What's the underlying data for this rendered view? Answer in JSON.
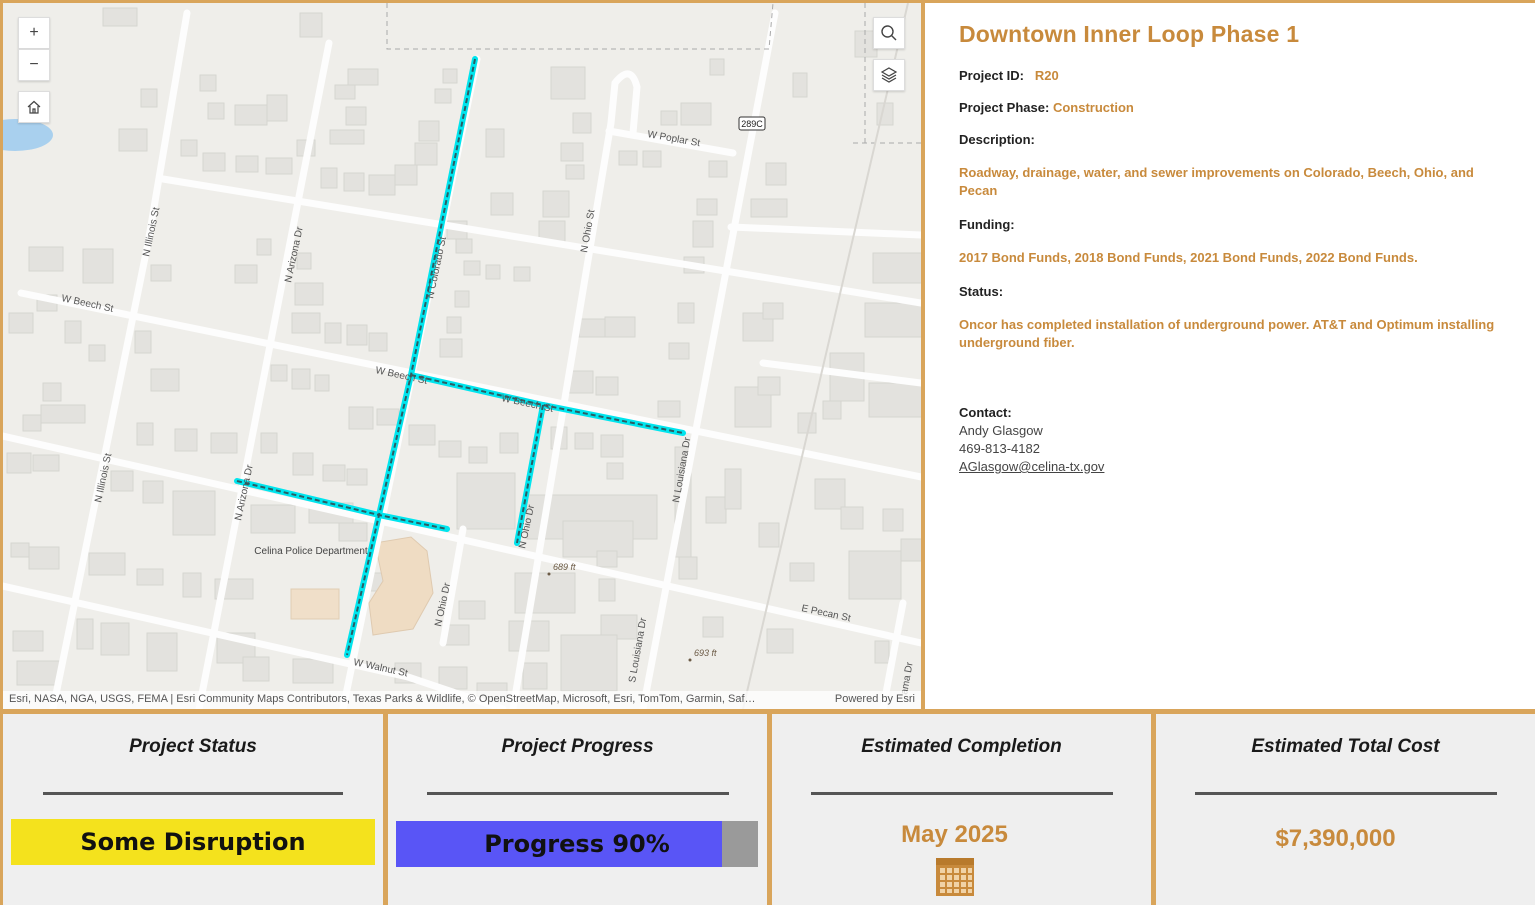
{
  "map": {
    "zoom_in_label": "+",
    "zoom_out_label": "−",
    "streets": [
      "W Poplar St",
      "N Illinois St",
      "N Arizona Dr",
      "N Colorado St",
      "N Ohio St",
      "W Beech St",
      "W Beech St",
      "W Beech St",
      "N Illinois St",
      "N Arizona Dr",
      "N Louisiana Dr",
      "E Pecan St",
      "N Ohio Dr",
      "W Walnut St",
      "S Louisiana Dr",
      "N Ohio Dr",
      "ama Dr"
    ],
    "highway_shield": "289C",
    "place_label": "Celina Police Department",
    "elevations": [
      "689 ft",
      "693 ft"
    ],
    "attribution": "Esri, NASA, NGA, USGS, FEMA | Esri Community Maps Contributors, Texas Parks & Wildlife, © OpenStreetMap, Microsoft, Esri, TomTom, Garmin, Saf…",
    "powered_by": "Powered by Esri",
    "route_color": "#00e5ee"
  },
  "details": {
    "title": "Downtown Inner Loop Phase 1",
    "project_id_label": "Project ID:",
    "project_id": "R20",
    "phase_label": "Project Phase:",
    "phase": "Construction",
    "description_label": "Description:",
    "description": "Roadway, drainage, water, and sewer improvements on Colorado, Beech, Ohio, and Pecan",
    "funding_label": "Funding:",
    "funding": "2017 Bond Funds, 2018 Bond Funds, 2021 Bond Funds, 2022 Bond Funds.",
    "status_label": "Status:",
    "status": "Oncor has completed installation of underground power. AT&T and Optimum installing underground fiber.",
    "contact_label": "Contact:",
    "contact_name": "Andy Glasgow",
    "contact_phone": "469-813-4182",
    "contact_email": "AGlasgow@celina-tx.gov",
    "accent_color": "#c88a3c"
  },
  "panels": {
    "status": {
      "title": "Project Status",
      "value": "Some Disruption",
      "color": "#f4e21d"
    },
    "progress": {
      "title": "Project Progress",
      "label": "Progress 90%",
      "fraction": 0.9,
      "color": "#5955f6"
    },
    "completion": {
      "title": "Estimated Completion",
      "value": "May 2025",
      "icon": "calendar-icon"
    },
    "cost": {
      "title": "Estimated Total Cost",
      "value": "$7,390,000"
    }
  }
}
